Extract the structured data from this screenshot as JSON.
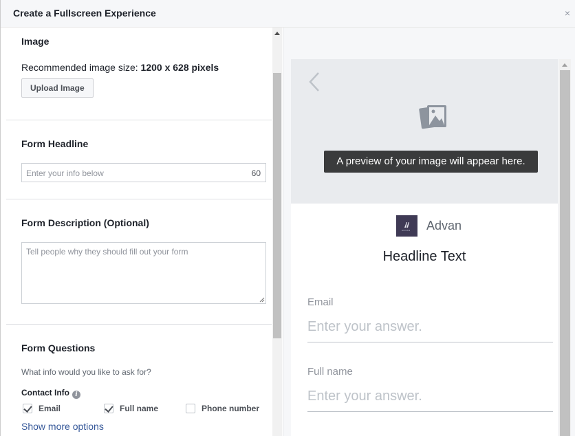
{
  "dialog": {
    "title": "Create a Fullscreen Experience",
    "close_glyph": "×"
  },
  "backdrop": {
    "glyph": "A"
  },
  "image_section": {
    "title": "Image",
    "recommended_prefix": "Recommended image size: ",
    "recommended_value": "1200 x 628 pixels",
    "upload_label": "Upload Image"
  },
  "headline_section": {
    "title": "Form Headline",
    "placeholder": "Enter your info below",
    "char_count": "60"
  },
  "description_section": {
    "title": "Form Description (Optional)",
    "placeholder": "Tell people why they should fill out your form"
  },
  "questions_section": {
    "title": "Form Questions",
    "subtitle": "What info would you like to ask for?",
    "contact_label": "Contact Info",
    "options": [
      {
        "label": "Email",
        "checked": true
      },
      {
        "label": "Full name",
        "checked": true
      },
      {
        "label": "Phone number",
        "checked": false
      }
    ],
    "more_link": "Show more options"
  },
  "preview": {
    "image_placeholder": "A preview of your image will appear here.",
    "brand_name": "Advan",
    "brand_logo_text": "ADVAN",
    "headline": "Headline Text",
    "fields": [
      {
        "label": "Email",
        "placeholder": "Enter your answer."
      },
      {
        "label": "Full name",
        "placeholder": "Enter your answer."
      }
    ]
  },
  "colors": {
    "link": "#365899",
    "tooltip_bg": "#3a3b3c",
    "brand_logo_bg": "#3f3a55"
  }
}
